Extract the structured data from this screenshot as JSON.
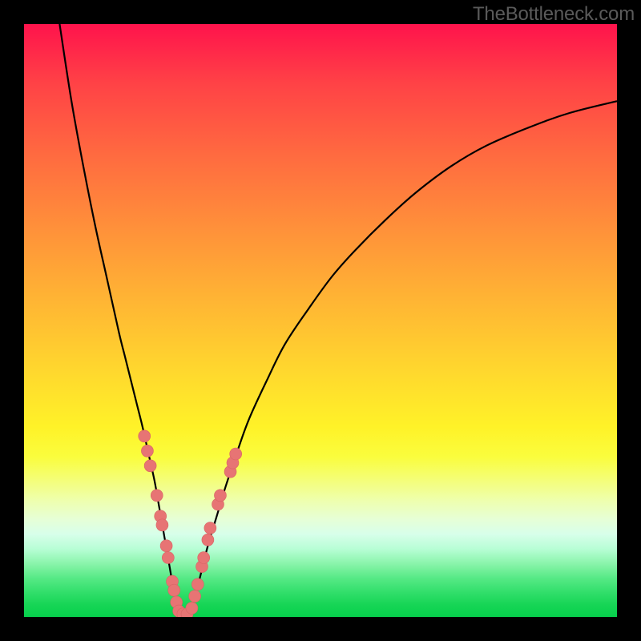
{
  "watermark": "TheBottleneck.com",
  "colors": {
    "curve": "#000000",
    "marker_fill": "#e77474",
    "marker_stroke": "#d86464"
  },
  "chart_data": {
    "type": "line",
    "title": "",
    "xlabel": "",
    "ylabel": "",
    "xlim": [
      0,
      100
    ],
    "ylim": [
      0,
      100
    ],
    "grid": false,
    "series": [
      {
        "name": "left-branch",
        "x": [
          6,
          8,
          10,
          12,
          14,
          16,
          17,
          18,
          19,
          20,
          21,
          22,
          22.8,
          23.5,
          24.2,
          24.8,
          25.4,
          26
        ],
        "y": [
          100,
          87,
          76,
          66,
          57,
          48,
          44,
          40,
          36,
          32,
          27.5,
          23,
          18.5,
          14.5,
          10.5,
          7,
          3.5,
          0.6
        ]
      },
      {
        "name": "right-branch",
        "x": [
          28,
          29,
          30,
          31,
          32.5,
          34,
          36,
          38,
          41,
          44,
          48,
          52,
          56,
          61,
          66,
          72,
          78,
          85,
          92,
          100
        ],
        "y": [
          0.6,
          4,
          8,
          12,
          17,
          22,
          28,
          33.5,
          40,
          46,
          52,
          57.5,
          62,
          67,
          71.5,
          76,
          79.5,
          82.5,
          85,
          87
        ]
      }
    ],
    "markers": [
      {
        "x": 20.3,
        "y": 30.5
      },
      {
        "x": 20.8,
        "y": 28
      },
      {
        "x": 21.3,
        "y": 25.5
      },
      {
        "x": 22.4,
        "y": 20.5
      },
      {
        "x": 23.0,
        "y": 17
      },
      {
        "x": 23.3,
        "y": 15.5
      },
      {
        "x": 24.0,
        "y": 12
      },
      {
        "x": 24.3,
        "y": 10
      },
      {
        "x": 25.0,
        "y": 6
      },
      {
        "x": 25.3,
        "y": 4.5
      },
      {
        "x": 25.7,
        "y": 2.5
      },
      {
        "x": 26.1,
        "y": 1
      },
      {
        "x": 26.8,
        "y": 0.5
      },
      {
        "x": 27.5,
        "y": 0.5
      },
      {
        "x": 28.3,
        "y": 1.5
      },
      {
        "x": 28.8,
        "y": 3.5
      },
      {
        "x": 29.3,
        "y": 5.5
      },
      {
        "x": 30.0,
        "y": 8.5
      },
      {
        "x": 30.3,
        "y": 10
      },
      {
        "x": 31.0,
        "y": 13
      },
      {
        "x": 31.4,
        "y": 15
      },
      {
        "x": 32.7,
        "y": 19
      },
      {
        "x": 33.1,
        "y": 20.5
      },
      {
        "x": 34.8,
        "y": 24.5
      },
      {
        "x": 35.2,
        "y": 26
      },
      {
        "x": 35.7,
        "y": 27.5
      }
    ]
  }
}
